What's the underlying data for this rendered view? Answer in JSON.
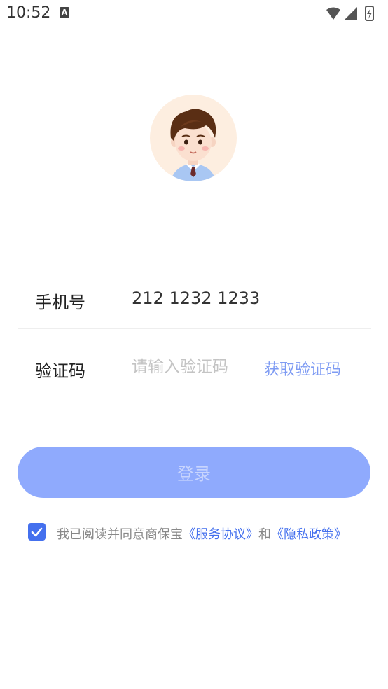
{
  "status_bar": {
    "time": "10:52",
    "notification_icon": "A"
  },
  "avatar": {
    "icon": "cartoon-boy-avatar"
  },
  "form": {
    "phone": {
      "label": "手机号",
      "value": "212 1232 1233"
    },
    "code": {
      "label": "验证码",
      "placeholder": "请输入验证码",
      "get_code_label": "获取验证码"
    }
  },
  "login_button": {
    "label": "登录"
  },
  "agreement": {
    "checked": true,
    "prefix": "我已阅读并同意商保宝",
    "service_link": "《服务协议》",
    "conjunction": "和",
    "privacy_link": "《隐私政策》"
  },
  "colors": {
    "accent": "#4470ee",
    "button_bg": "#8faafd",
    "link_light": "#7e9bf3"
  }
}
